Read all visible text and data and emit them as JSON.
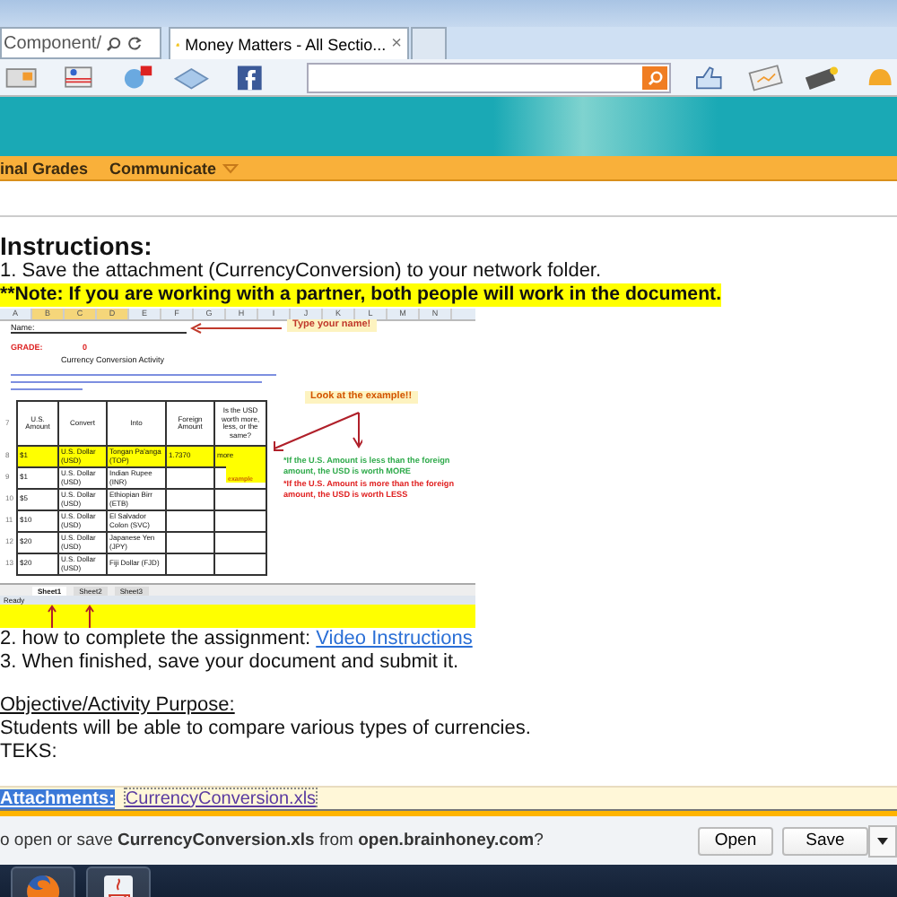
{
  "browser": {
    "address_fragment": "Component/",
    "tab_title": "Money Matters - All Sectio...",
    "tab_close": "×"
  },
  "nav": [
    {
      "label": "inal Grades",
      "has_menu": false
    },
    {
      "label": "Communicate",
      "has_menu": true
    }
  ],
  "content": {
    "heading": "Instructions:",
    "step_1": "1. Save the attachment (CurrencyConversion) to your network folder.",
    "note": "**Note: If you are working with a partner, both people will work in the document.",
    "spreadsheet": {
      "columns": [
        "A",
        "B",
        "C",
        "D",
        "E",
        "F",
        "G",
        "H",
        "I",
        "J",
        "K",
        "L",
        "M",
        "N"
      ],
      "name_label": "Name:",
      "name_hint": "Type your name!",
      "grade_label": "GRADE:",
      "grade_value": "0",
      "title": "Currency Conversion Activity",
      "example_hint": "Look at the example!!",
      "example_tag": "example",
      "table": {
        "header_row": "7",
        "headers": [
          "U.S. Amount",
          "Convert",
          "Into",
          "Foreign Amount",
          "Is the USD worth more, less, or the same?"
        ],
        "rows": [
          {
            "row": "8",
            "highlighted": true,
            "cells": [
              "$1",
              "U.S. Dollar (USD)",
              "Tongan Pa'anga (TOP)",
              "1.7370",
              "more"
            ]
          },
          {
            "row": "9",
            "highlighted": false,
            "cells": [
              "$1",
              "U.S. Dollar (USD)",
              "Indian Rupee (INR)",
              "",
              ""
            ]
          },
          {
            "row": "10",
            "highlighted": false,
            "cells": [
              "$5",
              "U.S. Dollar (USD)",
              "Ethiopian Birr (ETB)",
              "",
              ""
            ]
          },
          {
            "row": "11",
            "highlighted": false,
            "cells": [
              "$10",
              "U.S. Dollar (USD)",
              "El Salvador Colon (SVC)",
              "",
              ""
            ]
          },
          {
            "row": "12",
            "highlighted": false,
            "cells": [
              "$20",
              "U.S. Dollar (USD)",
              "Japanese Yen (JPY)",
              "",
              ""
            ]
          },
          {
            "row": "13",
            "highlighted": false,
            "cells": [
              "$20",
              "U.S. Dollar (USD)",
              "Fiji Dollar (FJD)",
              "",
              ""
            ]
          }
        ]
      },
      "notes": [
        {
          "text": "*If the U.S. Amount is less than the foreign amount, the USD is worth MORE",
          "color": "#2eaa4a"
        },
        {
          "text": "*If the U.S. Amount is more than the foreign amount, the USD is worth LESS",
          "color": "#e02020"
        }
      ],
      "sheet_tabs": [
        {
          "label": "Sheet1",
          "selected": true
        },
        {
          "label": "Sheet2",
          "selected": false
        },
        {
          "label": "Sheet3",
          "selected": false
        }
      ],
      "status": "Ready"
    },
    "step_2": {
      "text": "2. how to complete the assignment: ",
      "link": "Video Instructions"
    },
    "step_3": "3. When finished, save your document and submit it.",
    "objective_heading": "Objective/Activity Purpose:",
    "objective": "Students will be able to compare various types of currencies.",
    "teks": "TEKS:"
  },
  "attachments": {
    "label": "Attachments:",
    "file": "CurrencyConversion.xls"
  },
  "download_bar": {
    "message": "o open or save **CurrencyConversion.xls** from **open.brainhoney.com**?",
    "buttons": [
      "Open",
      "Save"
    ]
  },
  "taskbar": [
    {
      "kind": "firefox"
    },
    {
      "kind": "java"
    }
  ]
}
